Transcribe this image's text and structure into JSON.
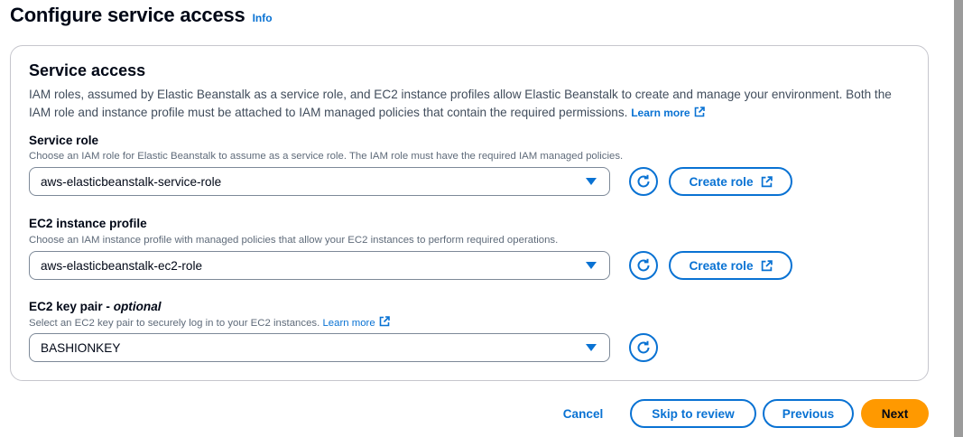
{
  "header": {
    "title": "Configure service access",
    "info": "Info"
  },
  "service_access": {
    "title": "Service access",
    "description": "IAM roles, assumed by Elastic Beanstalk as a service role, and EC2 instance profiles allow Elastic Beanstalk to create and manage your environment. Both the IAM role and instance profile must be attached to IAM managed policies that contain the required permissions.",
    "learn_more": "Learn more",
    "service_role": {
      "label": "Service role",
      "description": "Choose an IAM role for Elastic Beanstalk to assume as a service role. The IAM role must have the required IAM managed policies.",
      "value": "aws-elasticbeanstalk-service-role",
      "create_label": "Create role"
    },
    "instance_profile": {
      "label": "EC2 instance profile",
      "description": "Choose an IAM instance profile with managed policies that allow your EC2 instances to perform required operations.",
      "value": "aws-elasticbeanstalk-ec2-role",
      "create_label": "Create role"
    },
    "key_pair": {
      "label": "EC2 key pair",
      "optional": "optional",
      "description": "Select an EC2 key pair to securely log in to your EC2 instances.",
      "learn_more": "Learn more",
      "value": "BASHIONKEY"
    }
  },
  "footer": {
    "cancel": "Cancel",
    "skip": "Skip to review",
    "previous": "Previous",
    "next": "Next"
  },
  "colors": {
    "accent": "#0972d3",
    "primary_button": "#ff9900",
    "border": "#c6c6cd"
  },
  "icons": {
    "refresh": "refresh-icon",
    "external": "external-link-icon",
    "caret": "caret-down-icon"
  }
}
